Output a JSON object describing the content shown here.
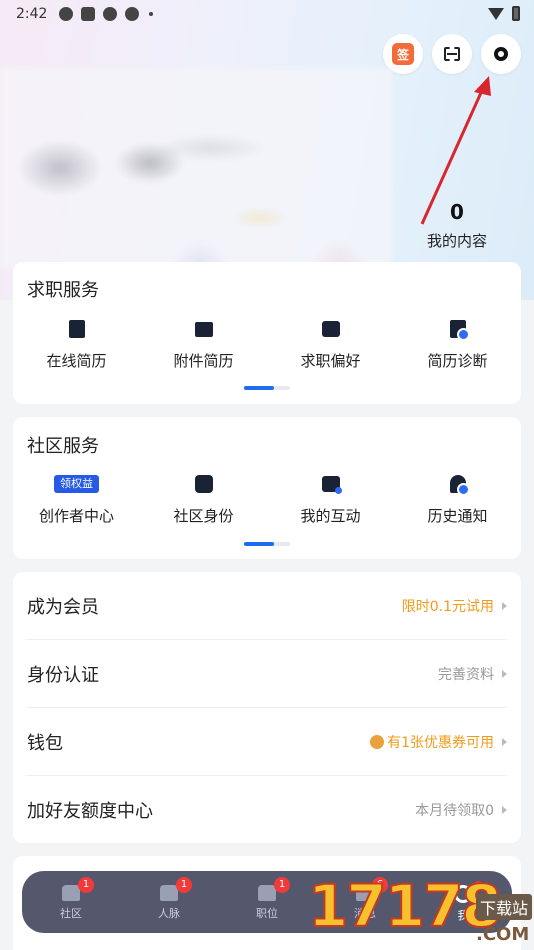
{
  "status_bar": {
    "time": "2:42"
  },
  "header": {
    "sign_icon_text": "签",
    "buttons": [
      "sign-in",
      "scan",
      "settings"
    ]
  },
  "profile": {
    "my_content_count": "0",
    "my_content_label": "我的内容"
  },
  "job_services": {
    "title": "求职服务",
    "items": [
      {
        "label": "在线简历",
        "icon": "online-resume-icon"
      },
      {
        "label": "附件简历",
        "icon": "attachment-resume-icon"
      },
      {
        "label": "求职偏好",
        "icon": "job-preference-icon"
      },
      {
        "label": "简历诊断",
        "icon": "resume-diagnosis-icon"
      }
    ]
  },
  "community_services": {
    "title": "社区服务",
    "badge_text": "领权益",
    "items": [
      {
        "label": "创作者中心",
        "icon": "creator-badge"
      },
      {
        "label": "社区身份",
        "icon": "community-id-icon"
      },
      {
        "label": "我的互动",
        "icon": "interaction-icon"
      },
      {
        "label": "历史通知",
        "icon": "notification-history-icon"
      }
    ]
  },
  "menu": [
    {
      "title": "成为会员",
      "right": "限时0.1元试用",
      "accent": "#f29a1b"
    },
    {
      "title": "身份认证",
      "right": "完善资料"
    },
    {
      "title": "钱包",
      "right": "有1张优惠券可用",
      "accent": "#f29a1b"
    },
    {
      "title": "加好友额度中心",
      "right": "本月待领取0"
    }
  ],
  "tabbar": {
    "tabs": [
      {
        "label": "社区",
        "badge": "1"
      },
      {
        "label": "人脉",
        "badge": "1"
      },
      {
        "label": "职位",
        "badge": "1"
      },
      {
        "label": "消息",
        "badge": "6"
      },
      {
        "label": "我"
      }
    ]
  },
  "watermark": {
    "number": "17178",
    "suffix": ".COM",
    "download_text": "下载站"
  },
  "colors": {
    "accent_blue": "#1f6cf0",
    "accent_orange": "#f29a1b",
    "badge_red": "#f33a3a",
    "annotation_arrow": "#d8262e"
  }
}
